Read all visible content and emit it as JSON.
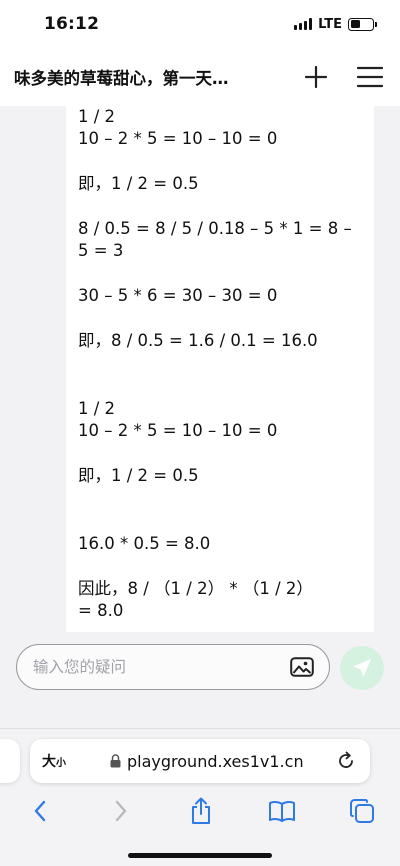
{
  "status_bar": {
    "time": "16:12",
    "network": "LTE",
    "battery_level": 0.45
  },
  "header": {
    "title": "味多美的草莓甜心，第一天…",
    "add_icon": "plus-icon",
    "menu_icon": "hamburger-menu-icon"
  },
  "message": {
    "lines": [
      "1 / 2",
      "10 – 2 * 5 = 10 – 10 = 0",
      "",
      "即，1 / 2 = 0.5",
      "",
      "8 / 0.5 = 8 / 5 / 0.18 – 5 * 1 = 8 –",
      "5 = 3",
      "",
      "30 – 5 * 6 = 30 – 30 = 0",
      "",
      "即，8 / 0.5 = 1.6 / 0.1 = 16.0",
      "",
      "",
      "1 / 2",
      "10 – 2 * 5 = 10 – 10 = 0",
      "",
      "即，1 / 2 = 0.5",
      "",
      "",
      "16.0 * 0.5 = 8.0",
      "",
      "因此，8 / （1 / 2） * （1 / 2）",
      "= 8.0"
    ]
  },
  "input": {
    "placeholder": "输入您的疑问",
    "value": ""
  },
  "browser": {
    "text_size_label_big": "大",
    "text_size_label_small": "小",
    "url": "playground.xes1v1.cn"
  },
  "colors": {
    "accent_send": "#d4f2df",
    "safari_blue": "#2f7ae5"
  }
}
